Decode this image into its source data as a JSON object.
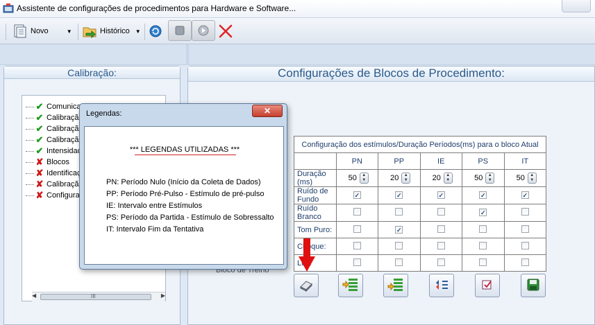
{
  "window": {
    "title": "Assistente de configurações de procedimentos para Hardware e Software..."
  },
  "toolbar": {
    "novo_label": "Novo",
    "historico_label": "Histórico"
  },
  "left_panel": {
    "title": "Calibração:",
    "tree": [
      {
        "label": "Comunicação",
        "status": "ok"
      },
      {
        "label": "Calibração",
        "status": "ok"
      },
      {
        "label": "Calibração",
        "status": "ok"
      },
      {
        "label": "Calibração",
        "status": "ok"
      },
      {
        "label": "Intensidade",
        "status": "ok"
      },
      {
        "label": "Blocos",
        "status": "error"
      },
      {
        "label": "Identificação",
        "status": "error"
      },
      {
        "label": "Calibração",
        "status": "error"
      },
      {
        "label": "Configuração",
        "status": "error"
      }
    ],
    "scroll_grip": "III"
  },
  "main_panel": {
    "title": "Configurações de Blocos de Procedimento:",
    "behind_text": "Bloco de Treino",
    "table": {
      "caption": "Configuração dos estímulos/Duração Períodos(ms) para o bloco Atual",
      "columns": [
        "PN",
        "PP",
        "IE",
        "PS",
        "IT"
      ],
      "duration_label": "Duração (ms)",
      "durations": [
        "50",
        "20",
        "20",
        "50",
        "50"
      ],
      "rows": [
        {
          "label": "Ruído de Fundo",
          "checks": [
            true,
            true,
            true,
            true,
            true
          ]
        },
        {
          "label": "Ruído Branco",
          "checks": [
            false,
            false,
            false,
            true,
            false
          ]
        },
        {
          "label": "Tom Puro:",
          "checks": [
            false,
            true,
            false,
            false,
            false
          ]
        },
        {
          "label": "Choque:",
          "checks": [
            false,
            false,
            false,
            false,
            false
          ]
        },
        {
          "label": "Luz:",
          "checks": [
            false,
            false,
            false,
            false,
            false
          ]
        }
      ]
    },
    "action_icons": [
      "eraser-icon",
      "insert-before-icon",
      "insert-after-icon",
      "reorder-icon",
      "checklist-icon",
      "save-icon"
    ]
  },
  "legend_dialog": {
    "title": "Legendas:",
    "close_glyph": "✕",
    "heading": "*** LEGENDAS UTILIZADAS ***",
    "items": [
      "PN: Período Nulo (Início da Coleta de Dados)",
      "PP: Período Pré-Pulso - Estímulo de pré-pulso",
      "IE: Intervalo entre Estímulos",
      "PS: Período da Partida - Estímulo de Sobressalto",
      "IT: Intervalo Fim da Tentativa"
    ]
  },
  "colors": {
    "accent_title": "#2b5a8a",
    "ok": "#1e9a1e",
    "error": "#d01818",
    "arrow": "#e01010"
  }
}
